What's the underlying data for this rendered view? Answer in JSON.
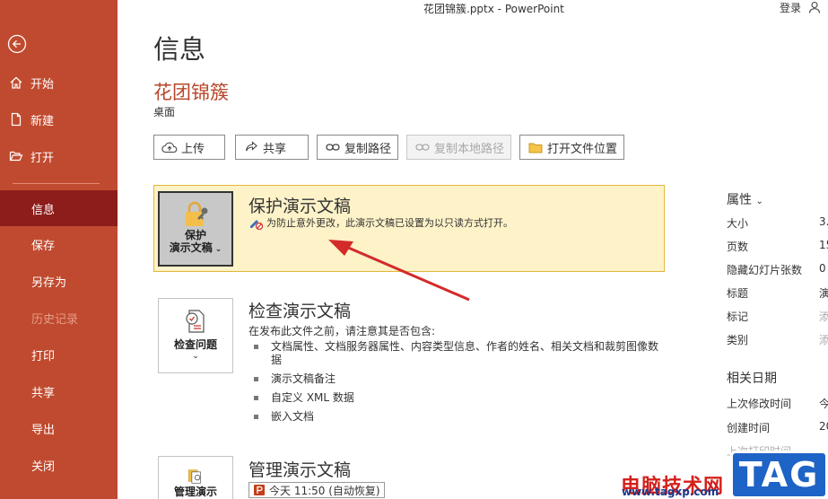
{
  "titlebar": {
    "document_title": "花团锦簇.pptx  -  PowerPoint",
    "login": "登录"
  },
  "sidebar": {
    "items": [
      {
        "label": "开始",
        "icon": "home-icon"
      },
      {
        "label": "新建",
        "icon": "new-file-icon"
      },
      {
        "label": "打开",
        "icon": "open-folder-icon"
      },
      {
        "label": "信息",
        "active": true
      },
      {
        "label": "保存"
      },
      {
        "label": "另存为"
      },
      {
        "label": "历史记录",
        "disabled": true
      },
      {
        "label": "打印"
      },
      {
        "label": "共享"
      },
      {
        "label": "导出"
      },
      {
        "label": "关闭"
      }
    ]
  },
  "page": {
    "title": "信息",
    "file_name": "花团锦簇",
    "file_location": "桌面"
  },
  "toolbar": {
    "upload": "上传",
    "share": "共享",
    "copy_path": "复制路径",
    "copy_local_path": "复制本地路径",
    "open_location": "打开文件位置"
  },
  "protect": {
    "tile_line1": "保护",
    "tile_line2": "演示文稿",
    "title": "保护演示文稿",
    "message": "为防止意外更改，此演示文稿已设置为以只读方式打开。"
  },
  "inspect": {
    "tile_label": "检查问题",
    "title": "检查演示文稿",
    "desc": "在发布此文件之前，请注意其是否包含:",
    "bullets": [
      "文档属性、文档服务器属性、内容类型信息、作者的姓名、相关文档和裁剪图像数据",
      "演示文稿备注",
      "自定义 XML 数据",
      "嵌入文档"
    ]
  },
  "manage": {
    "tile_label": "管理演示",
    "title": "管理演示文稿",
    "autosave": "今天 11:50 (自动恢复)"
  },
  "properties": {
    "heading": "属性",
    "rows": [
      {
        "key": "大小",
        "value": "3."
      },
      {
        "key": "页数",
        "value": "15"
      },
      {
        "key": "隐藏幻灯片张数",
        "value": "0"
      },
      {
        "key": "标题",
        "value": "演"
      },
      {
        "key": "标记",
        "value": "添",
        "placeholder": true
      },
      {
        "key": "类别",
        "value": "添",
        "placeholder": true
      }
    ],
    "dates_heading": "相关日期",
    "date_rows": [
      {
        "key": "上次修改时间",
        "value": "今"
      },
      {
        "key": "创建时间",
        "value": "20"
      },
      {
        "key": "上次打印时间",
        "value": ""
      }
    ]
  },
  "watermark": {
    "text": "电脑技术网",
    "url": "www.tagxp.com",
    "tag": "TAG"
  },
  "colors": {
    "sidebar": "#c04a2f",
    "sidebar_active": "#8d1d1a",
    "accent": "#b7472a",
    "protect_bg": "#fdf2c8",
    "arrow": "#d42a2a"
  }
}
